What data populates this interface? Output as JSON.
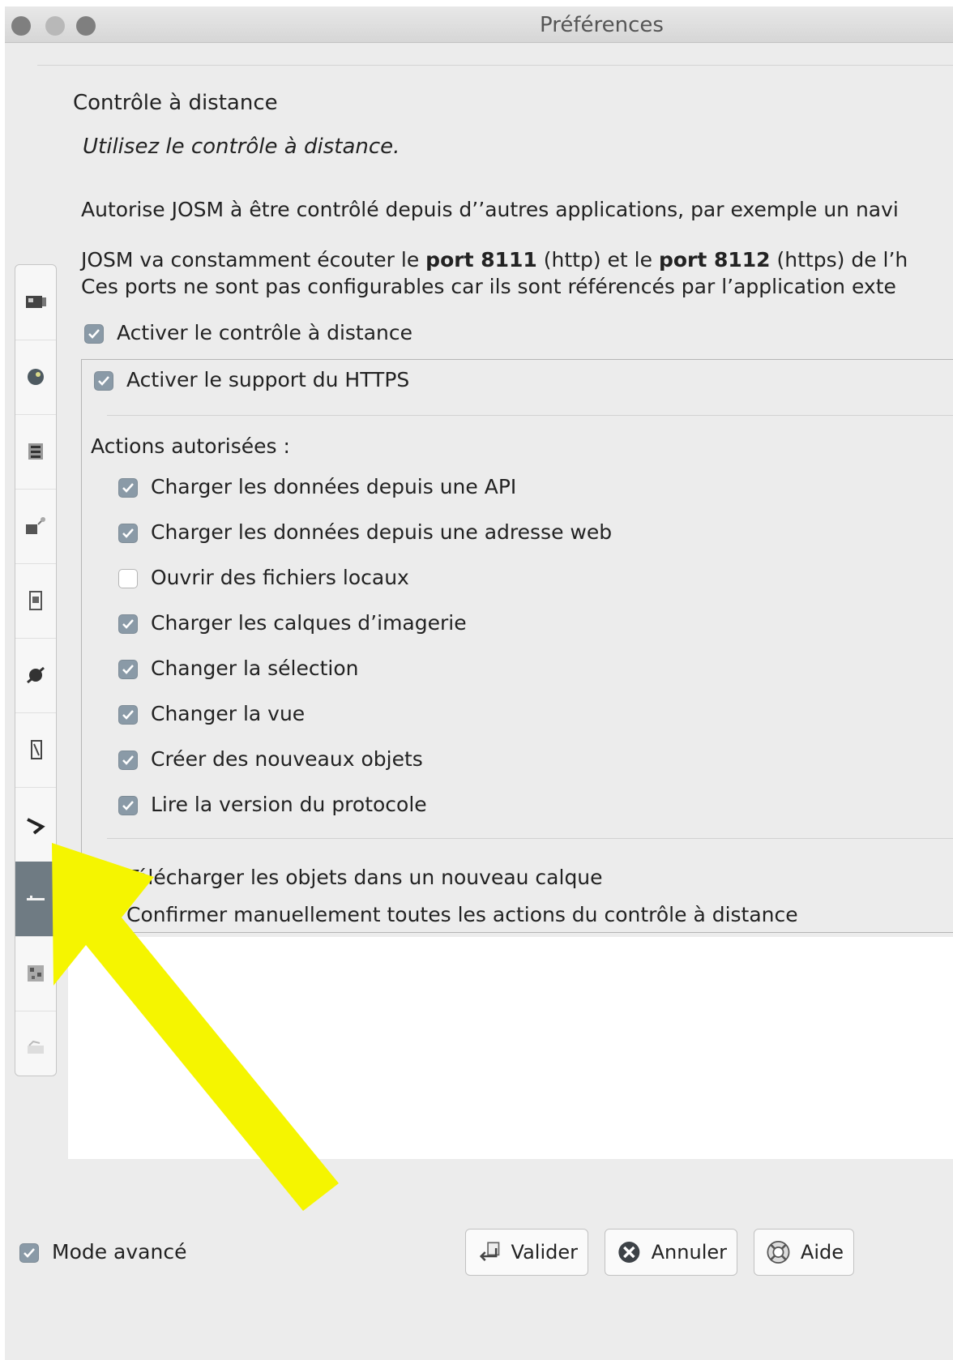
{
  "window": {
    "title": "Préférences"
  },
  "page": {
    "heading": "Contrôle à distance",
    "subtitle": "Utilisez le contrôle à distance.",
    "description_1": "Autorise JOSM à être contrôlé depuis d’’autres applications, par exemple un navi",
    "description_2_parts": [
      "JOSM va constamment écouter le ",
      "port 8111",
      " (http) et le ",
      "port 8112",
      " (https) de l’h"
    ],
    "description_3": "Ces ports ne sont pas configurables car ils sont référencés par l’application exte"
  },
  "remote_control": {
    "label": "Activer le contrôle à distance",
    "checked": true
  },
  "https_support": {
    "label": "Activer le support du HTTPS",
    "checked": true
  },
  "actions": {
    "heading": "Actions autorisées :",
    "items": [
      {
        "label": "Charger les données depuis une API",
        "checked": true
      },
      {
        "label": "Charger les données depuis une adresse web",
        "checked": true
      },
      {
        "label": "Ouvrir des fichiers locaux",
        "checked": false
      },
      {
        "label": "Charger les calques d’imagerie",
        "checked": true
      },
      {
        "label": "Changer la sélection",
        "checked": true
      },
      {
        "label": "Changer la vue",
        "checked": true
      },
      {
        "label": "Créer des nouveaux objets",
        "checked": true
      },
      {
        "label": "Lire la version du protocole",
        "checked": true
      }
    ]
  },
  "extra_options": [
    {
      "label": "Télécharger les objets dans un nouveau calque"
    },
    {
      "label": "Confirmer manuellement toutes les actions du contrôle à distance"
    }
  ],
  "footer": {
    "expert_mode": {
      "label": "Mode avancé",
      "checked": true
    },
    "buttons": {
      "ok": "Valider",
      "cancel": "Annuler",
      "help": "Aide"
    }
  },
  "sidebar": {
    "tabs": [
      "display-settings-icon",
      "map-settings-icon",
      "connection-settings-icon",
      "imagery-settings-icon",
      "presets-icon",
      "plugins-icon",
      "shortcuts-icon",
      "validator-icon",
      "remote-control-icon",
      "projection-icon",
      "advanced-icon"
    ],
    "selected_index": 8
  },
  "annotation": {
    "arrow_color": "#f5f500"
  },
  "colors": {
    "checkbox_checked": "#8a9aa7",
    "selected_tab": "#6f7b83"
  }
}
